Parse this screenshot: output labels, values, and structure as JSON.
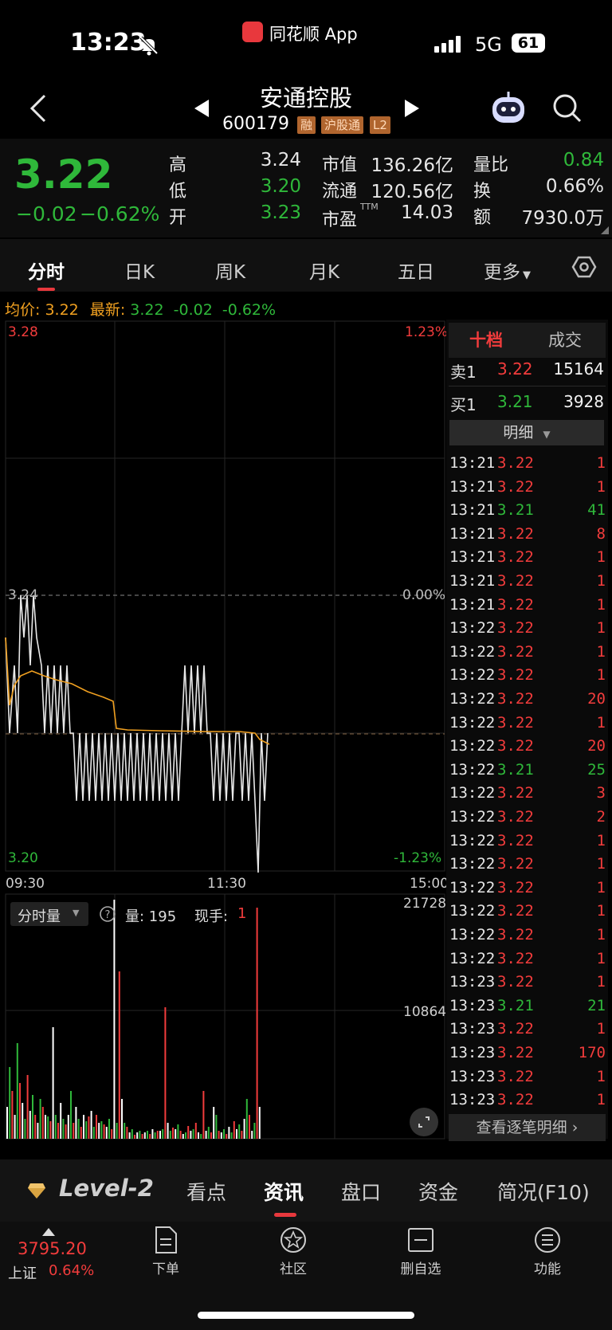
{
  "status": {
    "time": "13:23",
    "app_name": "同花顺 App",
    "network": "5G",
    "battery": "61"
  },
  "header": {
    "name": "安通控股",
    "code": "600179",
    "tags": [
      "融",
      "沪股通",
      "L2"
    ]
  },
  "quote": {
    "price": "3.22",
    "change": "−0.02",
    "change_pct": "−0.62%",
    "fields": [
      {
        "label": "高",
        "value": "3.24",
        "color": "#f2f2f2"
      },
      {
        "label": "低",
        "value": "3.20",
        "color": "#2fb83a"
      },
      {
        "label": "开",
        "value": "3.23",
        "color": "#2fb83a"
      },
      {
        "label": "市值",
        "value": "136.26亿",
        "color": "#f2f2f2"
      },
      {
        "label": "流通",
        "value": "120.56亿",
        "color": "#f2f2f2"
      },
      {
        "label": "市盈",
        "sup": "TTM",
        "value": "14.03",
        "color": "#f2f2f2"
      },
      {
        "label": "量比",
        "value": "0.84",
        "color": "#2fb83a"
      },
      {
        "label": "换",
        "value": "0.66%",
        "color": "#f2f2f2"
      },
      {
        "label": "额",
        "value": "7930.0万",
        "color": "#f2f2f2"
      }
    ]
  },
  "tabs": [
    "分时",
    "日K",
    "周K",
    "月K",
    "五日",
    "更多"
  ],
  "avg_line": {
    "avg_label": "均价:",
    "avg": "3.22",
    "latest_label": "最新:",
    "latest": "3.22",
    "chg": "-0.02",
    "pct": "-0.62%"
  },
  "chart_data": {
    "type": "line",
    "y_top": "3.28",
    "y_mid": "3.24",
    "y_bot": "3.20",
    "pct_top": "1.23%",
    "pct_mid": "0.00%",
    "pct_bot": "-1.23%",
    "x_labels": [
      "09:30",
      "11:30",
      "15:00"
    ],
    "volume_label": "分时量",
    "volume_info": "量: 195",
    "current_hand_label": "现手:",
    "current_hand": "1",
    "volume_top": "21728",
    "volume_mid": "10864"
  },
  "book": {
    "tab_active": "十档",
    "tab_other": "成交",
    "sell": {
      "label": "卖1",
      "price": "3.22",
      "vol": "15164"
    },
    "buy": {
      "label": "买1",
      "price": "3.21",
      "vol": "3928"
    },
    "detail_label": "明细",
    "view_all": "查看逐笔明细",
    "trades": [
      {
        "t": "13:21",
        "p": "3.22",
        "v": "1",
        "c": "#f23c3c"
      },
      {
        "t": "13:21",
        "p": "3.22",
        "v": "1",
        "c": "#f23c3c"
      },
      {
        "t": "13:21",
        "p": "3.21",
        "v": "41",
        "c": "#2fb83a"
      },
      {
        "t": "13:21",
        "p": "3.22",
        "v": "8",
        "c": "#f23c3c"
      },
      {
        "t": "13:21",
        "p": "3.22",
        "v": "1",
        "c": "#f23c3c"
      },
      {
        "t": "13:21",
        "p": "3.22",
        "v": "1",
        "c": "#f23c3c"
      },
      {
        "t": "13:21",
        "p": "3.22",
        "v": "1",
        "c": "#f23c3c"
      },
      {
        "t": "13:22",
        "p": "3.22",
        "v": "1",
        "c": "#f23c3c"
      },
      {
        "t": "13:22",
        "p": "3.22",
        "v": "1",
        "c": "#f23c3c"
      },
      {
        "t": "13:22",
        "p": "3.22",
        "v": "1",
        "c": "#f23c3c"
      },
      {
        "t": "13:22",
        "p": "3.22",
        "v": "20",
        "c": "#f23c3c"
      },
      {
        "t": "13:22",
        "p": "3.22",
        "v": "1",
        "c": "#f23c3c"
      },
      {
        "t": "13:22",
        "p": "3.22",
        "v": "20",
        "c": "#f23c3c"
      },
      {
        "t": "13:22",
        "p": "3.21",
        "v": "25",
        "c": "#2fb83a"
      },
      {
        "t": "13:22",
        "p": "3.22",
        "v": "3",
        "c": "#f23c3c"
      },
      {
        "t": "13:22",
        "p": "3.22",
        "v": "2",
        "c": "#f23c3c"
      },
      {
        "t": "13:22",
        "p": "3.22",
        "v": "1",
        "c": "#f23c3c"
      },
      {
        "t": "13:22",
        "p": "3.22",
        "v": "1",
        "c": "#f23c3c"
      },
      {
        "t": "13:22",
        "p": "3.22",
        "v": "1",
        "c": "#f23c3c"
      },
      {
        "t": "13:22",
        "p": "3.22",
        "v": "1",
        "c": "#f23c3c"
      },
      {
        "t": "13:22",
        "p": "3.22",
        "v": "1",
        "c": "#f23c3c"
      },
      {
        "t": "13:22",
        "p": "3.22",
        "v": "1",
        "c": "#f23c3c"
      },
      {
        "t": "13:23",
        "p": "3.22",
        "v": "1",
        "c": "#f23c3c"
      },
      {
        "t": "13:23",
        "p": "3.21",
        "v": "21",
        "c": "#2fb83a"
      },
      {
        "t": "13:23",
        "p": "3.22",
        "v": "1",
        "c": "#f23c3c"
      },
      {
        "t": "13:23",
        "p": "3.22",
        "v": "170",
        "c": "#f23c3c"
      },
      {
        "t": "13:23",
        "p": "3.22",
        "v": "1",
        "c": "#f23c3c"
      },
      {
        "t": "13:23",
        "p": "3.22",
        "v": "1",
        "c": "#f23c3c"
      }
    ]
  },
  "info_tabs": {
    "level2": "Level-2",
    "items": [
      "看点",
      "资讯",
      "盘口",
      "资金",
      "简况(F10)"
    ]
  },
  "footer": {
    "index_value": "3795.20",
    "index_name": "上证",
    "index_pct": "0.64%",
    "items": [
      "下单",
      "社区",
      "删自选",
      "功能"
    ]
  }
}
